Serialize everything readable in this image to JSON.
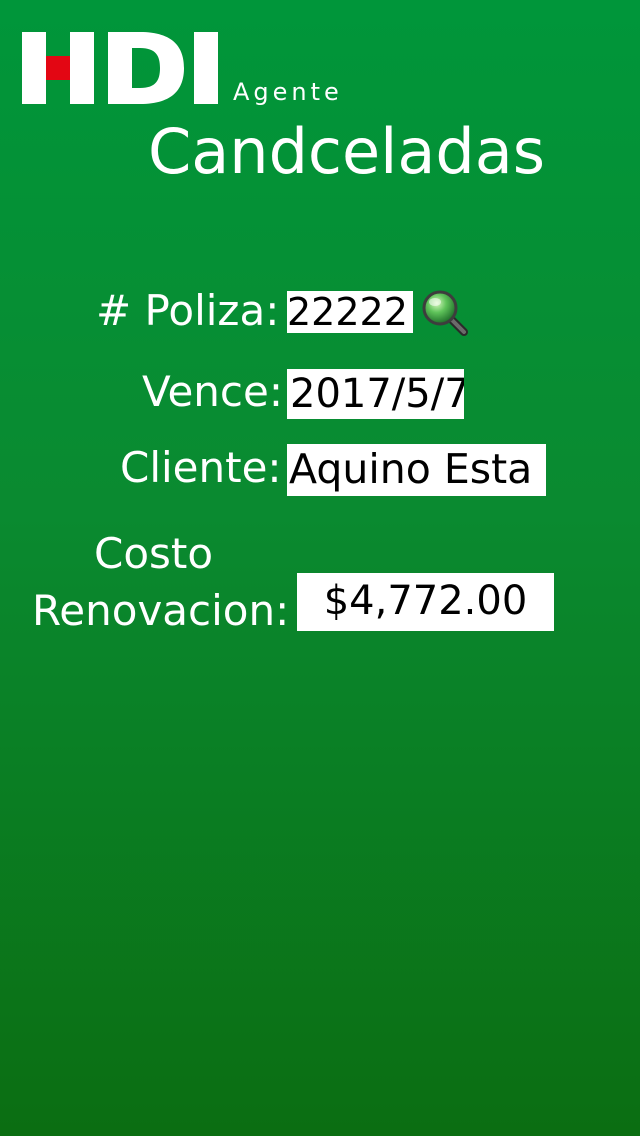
{
  "header": {
    "brand": "HDI",
    "brand_sub": "Agente",
    "title": "Candceladas",
    "logo_colors": {
      "letters": "#ffffff",
      "accent": "#e30613"
    }
  },
  "form": {
    "poliza": {
      "label": "# Poliza:",
      "value": "22222",
      "search_icon": "magnifier-icon"
    },
    "vence": {
      "label": "Vence:",
      "value": "2017/5/7"
    },
    "cliente": {
      "label": "Cliente:",
      "value": "Aquino Esta"
    },
    "costo": {
      "label_line1": "Costo",
      "label_line2": "Renovacion:",
      "value": "$4,772.00"
    }
  },
  "colors": {
    "background_top": "#00963a",
    "background_bottom": "#0b6e12",
    "field_background": "#ffffff"
  }
}
